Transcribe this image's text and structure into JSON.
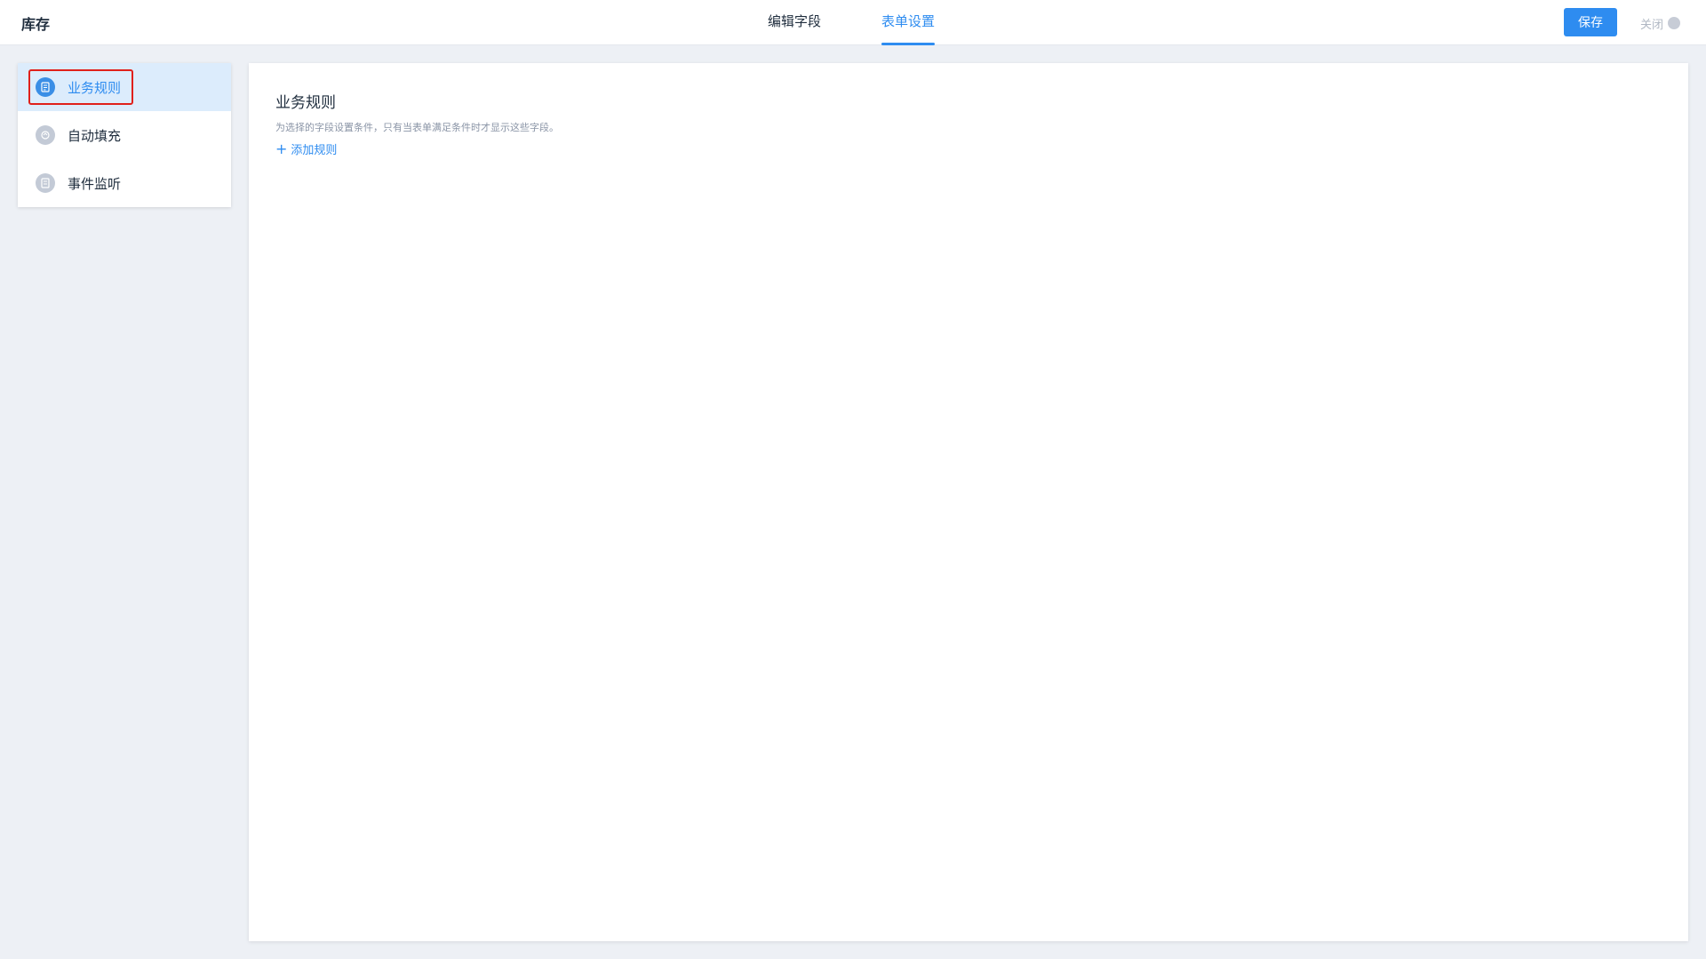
{
  "app": {
    "title": "库存"
  },
  "tabs": [
    {
      "label": "编辑字段",
      "active": false
    },
    {
      "label": "表单设置",
      "active": true
    }
  ],
  "toolbar": {
    "save_label": "保存",
    "close_label": "关闭"
  },
  "sidebar": {
    "items": [
      {
        "label": "业务规则",
        "icon": "rule-icon",
        "active": true
      },
      {
        "label": "自动填充",
        "icon": "autofill-icon",
        "active": false
      },
      {
        "label": "事件监听",
        "icon": "event-icon",
        "active": false
      }
    ]
  },
  "main": {
    "title": "业务规则",
    "description": "为选择的字段设置条件，只有当表单满足条件时才显示这些字段。",
    "add_rule_label": "添加规则"
  },
  "colors": {
    "accent": "#2e8cf0",
    "highlight_border": "#e0201b",
    "active_item_bg": "#dcecfc",
    "page_bg": "#edf0f5"
  }
}
